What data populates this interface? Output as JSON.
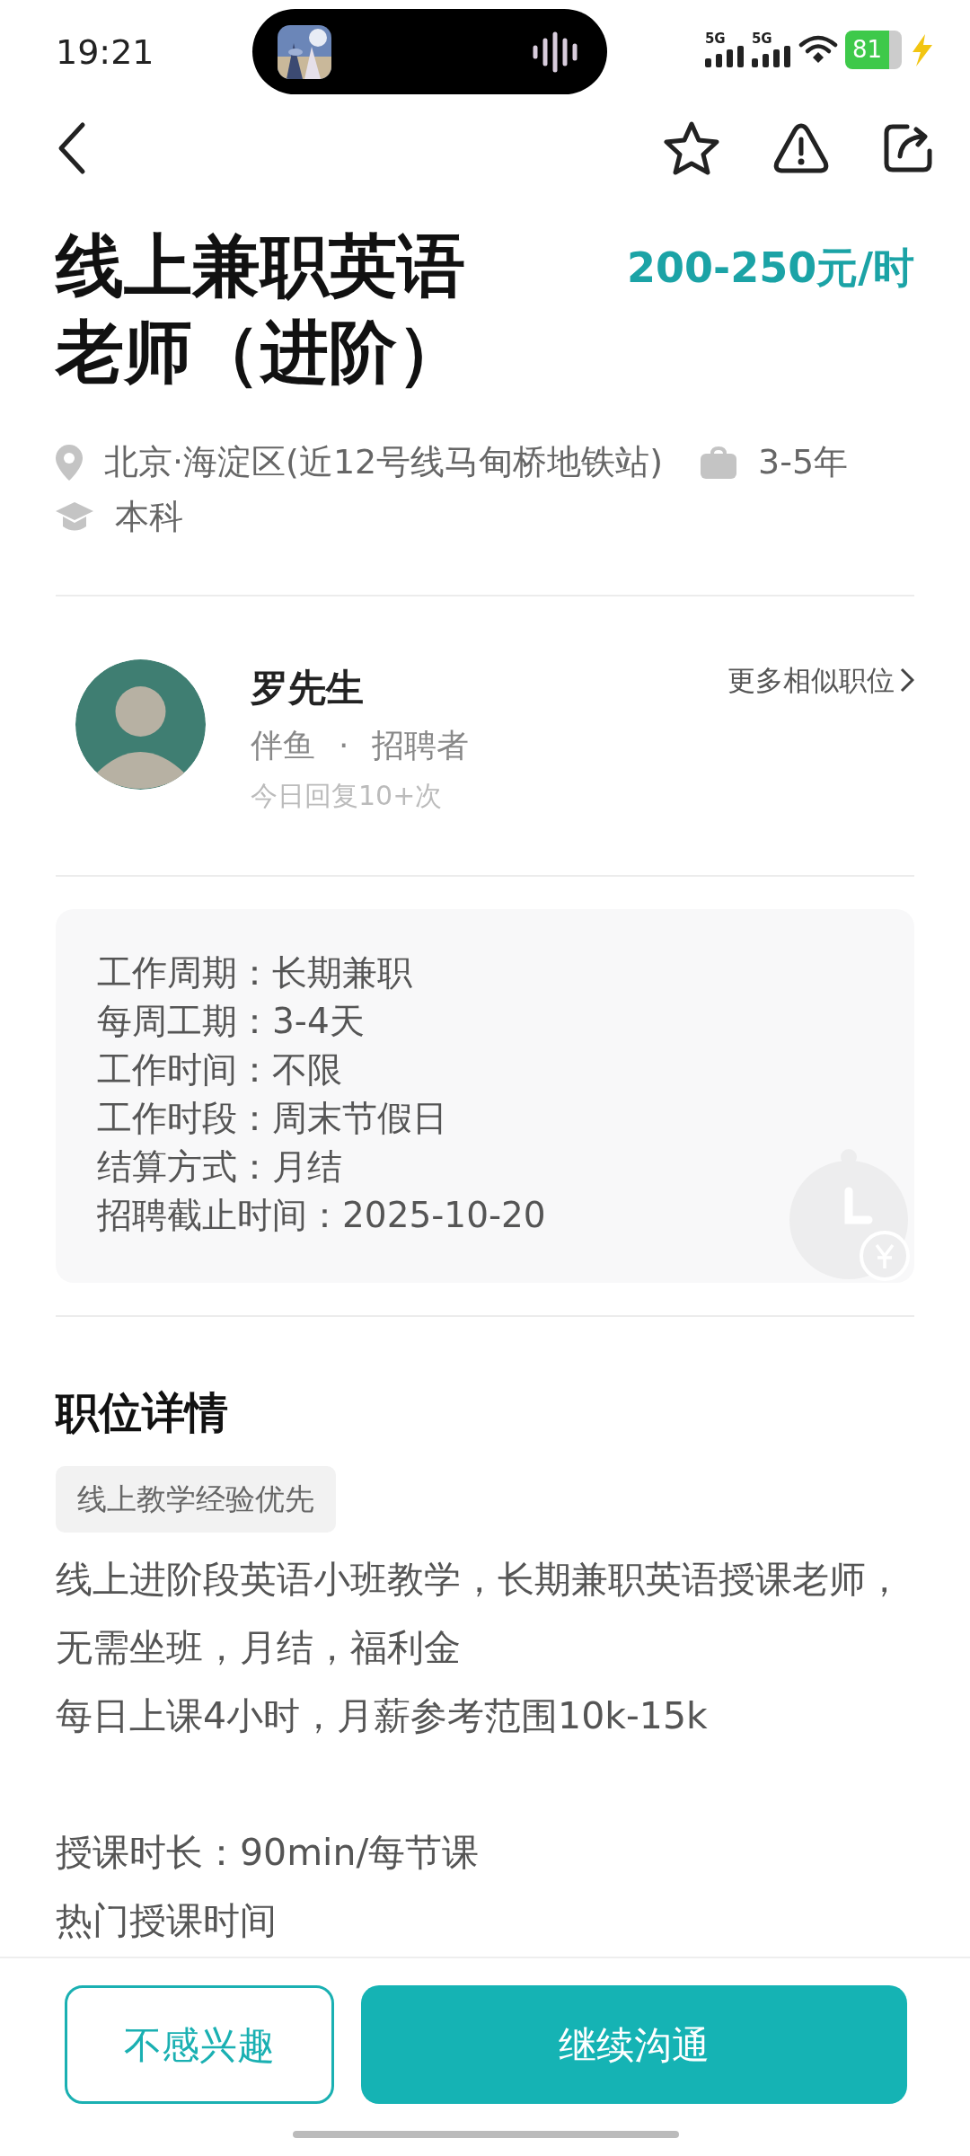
{
  "status_bar": {
    "time": "19:21",
    "networks": [
      "5G",
      "5G"
    ],
    "battery": "81"
  },
  "job": {
    "title": "线上兼职英语老师（进阶）",
    "salary": "200-250元/时",
    "location": "北京·海淀区(近12号线马甸桥地铁站)",
    "experience": "3-5年",
    "education": "本科"
  },
  "recruiter": {
    "name": "罗先生",
    "company": "伴鱼",
    "separator": "·",
    "role": "招聘者",
    "reply_rate": "今日回复10+次",
    "more_link": "更多相似职位"
  },
  "work_info": [
    "工作周期：长期兼职",
    "每周工期：3-4天",
    "工作时间：不限",
    "工作时段：周末节假日",
    "结算方式：月结",
    "招聘截止时间：2025-10-20"
  ],
  "details": {
    "heading": "职位详情",
    "tags": [
      "线上教学经验优先"
    ],
    "blocks": [
      [
        "线上进阶段英语小班教学，长期兼职英语授课老师，无需坐班，月结，福利金",
        "每日上课4小时，月薪参考范围10k-15k"
      ],
      [
        "授课时长：90min/每节课",
        "热门授课时间"
      ]
    ]
  },
  "actions": [
    {
      "label": "不感兴趣",
      "kind": "outline"
    },
    {
      "label": "继续沟通",
      "kind": "primary"
    }
  ]
}
